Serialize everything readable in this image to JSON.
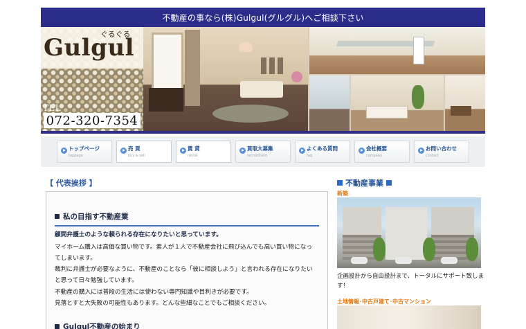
{
  "header": {
    "banner_text": "不動産の事なら(株)Gulgul(グルグル)へご相談下さい",
    "logo_kana": "ぐるぐる",
    "logo_text": "Gulgul",
    "tel_label": "TEL",
    "tel_number": "072-320-7354"
  },
  "nav": {
    "items": [
      {
        "label": "トップページ",
        "sub": "toppage"
      },
      {
        "label": "売 買",
        "sub": "buy & sell"
      },
      {
        "label": "賃 貸",
        "sub": "rental"
      },
      {
        "label": "買取大募集",
        "sub": "recruitment"
      },
      {
        "label": "よくある質問",
        "sub": "faq"
      },
      {
        "label": "会社概要",
        "sub": "company"
      },
      {
        "label": "お問い合わせ",
        "sub": "contact"
      }
    ]
  },
  "main": {
    "section_title": "【 代表挨拶 】",
    "heading1": "私の目指す不動産業",
    "lead": "顧問弁護士のような頼られる存在になりたいと思っています。",
    "lines": [
      "マイホーム購入は高価な買い物です。素人が１人で不動産会社に飛び込んでも高い買い物になっ",
      "てしまいます。",
      "裁判に弁護士が必要なように、不動産のことなら「彼に相談しよう」と言われる存在になりたい",
      "と思って日々勉強しています。",
      "不動産の購入には普段の生活には使わない専門知識や目利きが必要です。",
      "見落とすと大失敗の可能性もあります。どんな些細なことでもご相談ください。"
    ],
    "heading2": "Gulgul不動産の始まり"
  },
  "sidebar": {
    "title": "不動産事業",
    "cat1": "新築",
    "text1_line1": "企画設計から自由設計まで、トータルにサポート致しま",
    "text1_line2": "す！",
    "cat2": "土地情報･中古戸建て･中古マンション"
  },
  "colors": {
    "banner": "#2c2c8a",
    "nav_text": "#1e4f96",
    "accent_orange": "#e07810",
    "heading_rule": "#3b6db8"
  }
}
